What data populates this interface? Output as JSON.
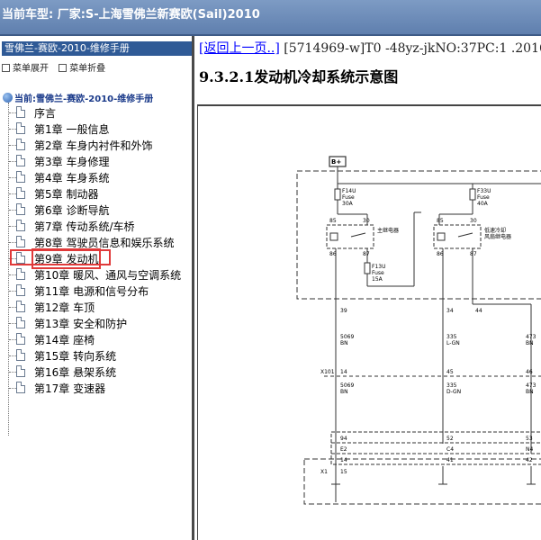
{
  "window": {
    "title": "当前车型: 厂家:S-上海雪佛兰新赛欧(Sail)2010"
  },
  "left_pane": {
    "header": "雪佛兰-赛欧-2010-维修手册",
    "toolbar": {
      "expand_label": "菜单展开",
      "collapse_label": "菜单折叠"
    },
    "root_label": "当前:雪佛兰-赛欧-2010-维修手册",
    "items": [
      {
        "label": "序言"
      },
      {
        "label": "第1章 一般信息"
      },
      {
        "label": "第2章 车身内衬件和外饰"
      },
      {
        "label": "第3章 车身修理"
      },
      {
        "label": "第4章 车身系统"
      },
      {
        "label": "第5章 制动器"
      },
      {
        "label": "第6章 诊断导航"
      },
      {
        "label": "第7章 传动系统/车桥"
      },
      {
        "label": "第8章 驾驶员信息和娱乐系统"
      },
      {
        "label": "第9章 发动机",
        "selected": true
      },
      {
        "label": "第10章 暖风、通风与空调系统"
      },
      {
        "label": "第11章 电源和信号分布"
      },
      {
        "label": "第12章 车顶"
      },
      {
        "label": "第13章 安全和防护"
      },
      {
        "label": "第14章 座椅"
      },
      {
        "label": "第15章 转向系统"
      },
      {
        "label": "第16章 悬架系统"
      },
      {
        "label": "第17章 变速器"
      }
    ]
  },
  "content": {
    "back_link": "[返回上一页..]",
    "doc_ref": "[5714969-w]T0 -48yz-jkNO:37PC:1 .2016",
    "section_title": "9.3.2.1发动机冷却系统示意图",
    "diagram": {
      "battery_label": "B+",
      "fuse1": [
        "F14U",
        "Fuse",
        "30A"
      ],
      "fuse2": [
        "F33U",
        "Fuse",
        "40A"
      ],
      "fuse3": [
        "F13U",
        "Fuse",
        "15A"
      ],
      "relay1_label": "主继电器",
      "relay2_label": [
        "低速冷却",
        "风扇继电器"
      ],
      "pins": {
        "r1_85": "85",
        "r1_30": "30",
        "r1_86": "86",
        "r1_87": "87",
        "r2_85": "85",
        "r2_30": "30",
        "r2_86": "86",
        "r2_87": "87"
      },
      "circuits": {
        "c1": "39",
        "c2": "34",
        "c3": "44"
      },
      "wire1": [
        "5069",
        "BN"
      ],
      "wire2": [
        "335",
        "L-GN"
      ],
      "wire3": [
        "473",
        "BN"
      ],
      "connector_x101": "X101",
      "x101_pins": [
        "14",
        "45",
        "46"
      ],
      "wire4": [
        "5069",
        "BN"
      ],
      "wire5": [
        "335",
        "D-GN"
      ],
      "wire6": [
        "473",
        "BN"
      ],
      "e_pins": [
        "94",
        "E2",
        "14"
      ],
      "c_pins": [
        "52",
        "C4",
        "41"
      ],
      "n_pins": [
        "53",
        "N4",
        "42"
      ],
      "connector_x1": "X1",
      "x1_pins": [
        "15",
        "",
        ""
      ]
    }
  }
}
